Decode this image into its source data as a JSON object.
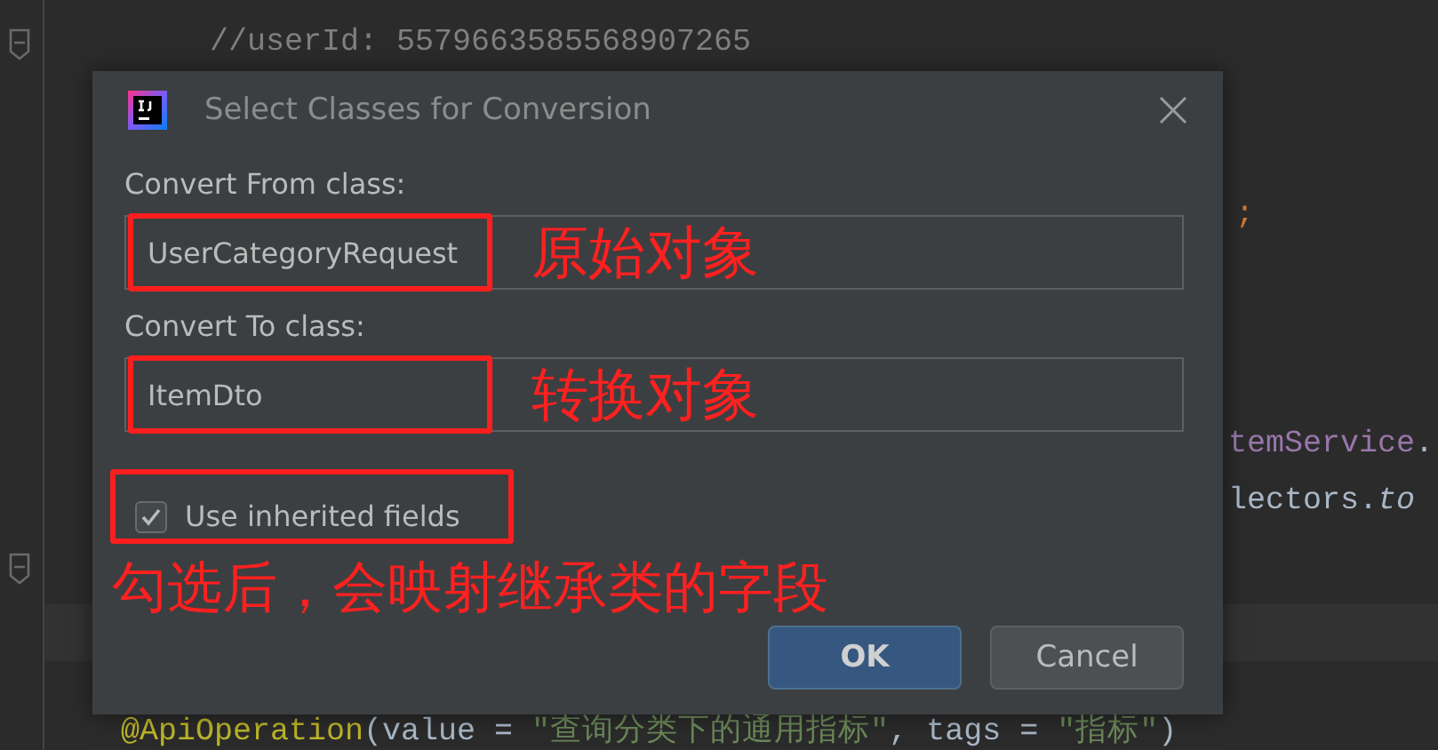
{
  "editor": {
    "code_lines": [
      {
        "tokens": [
          {
            "kind": "comment",
            "text": "//userId: 5579663585568907265"
          }
        ]
      },
      {
        "tokens": [
          {
            "kind": "keyword",
            "text": ";"
          }
        ]
      },
      {
        "tokens": [
          {
            "kind": "field",
            "text": "temService"
          },
          {
            "kind": "plain",
            "text": "."
          }
        ]
      },
      {
        "tokens": [
          {
            "kind": "plain",
            "text": "lectors."
          },
          {
            "kind": "italic",
            "text": "to"
          }
        ]
      },
      {
        "tokens": [
          {
            "kind": "annotation",
            "text": "@ApiOperation"
          },
          {
            "kind": "plain",
            "text": "(value = "
          },
          {
            "kind": "string",
            "text": "\"查询分类下的通用指标\""
          },
          {
            "kind": "plain",
            "text": ", tags = "
          },
          {
            "kind": "string",
            "text": "\"指标\""
          },
          {
            "kind": "plain",
            "text": ")"
          }
        ]
      }
    ]
  },
  "dialog": {
    "title": "Select Classes for Conversion",
    "fields": [
      {
        "label": "Convert From class:",
        "value": "UserCategoryRequest",
        "note": "原始对象"
      },
      {
        "label": "Convert To class:",
        "value": "ItemDto",
        "note": "转换对象"
      }
    ],
    "checkbox": {
      "label": "Use inherited fields",
      "checked": true
    },
    "checkbox_note": "勾选后，会映射继承类的字段",
    "buttons": [
      {
        "label": "OK",
        "default": true
      },
      {
        "label": "Cancel",
        "default": false
      }
    ]
  }
}
